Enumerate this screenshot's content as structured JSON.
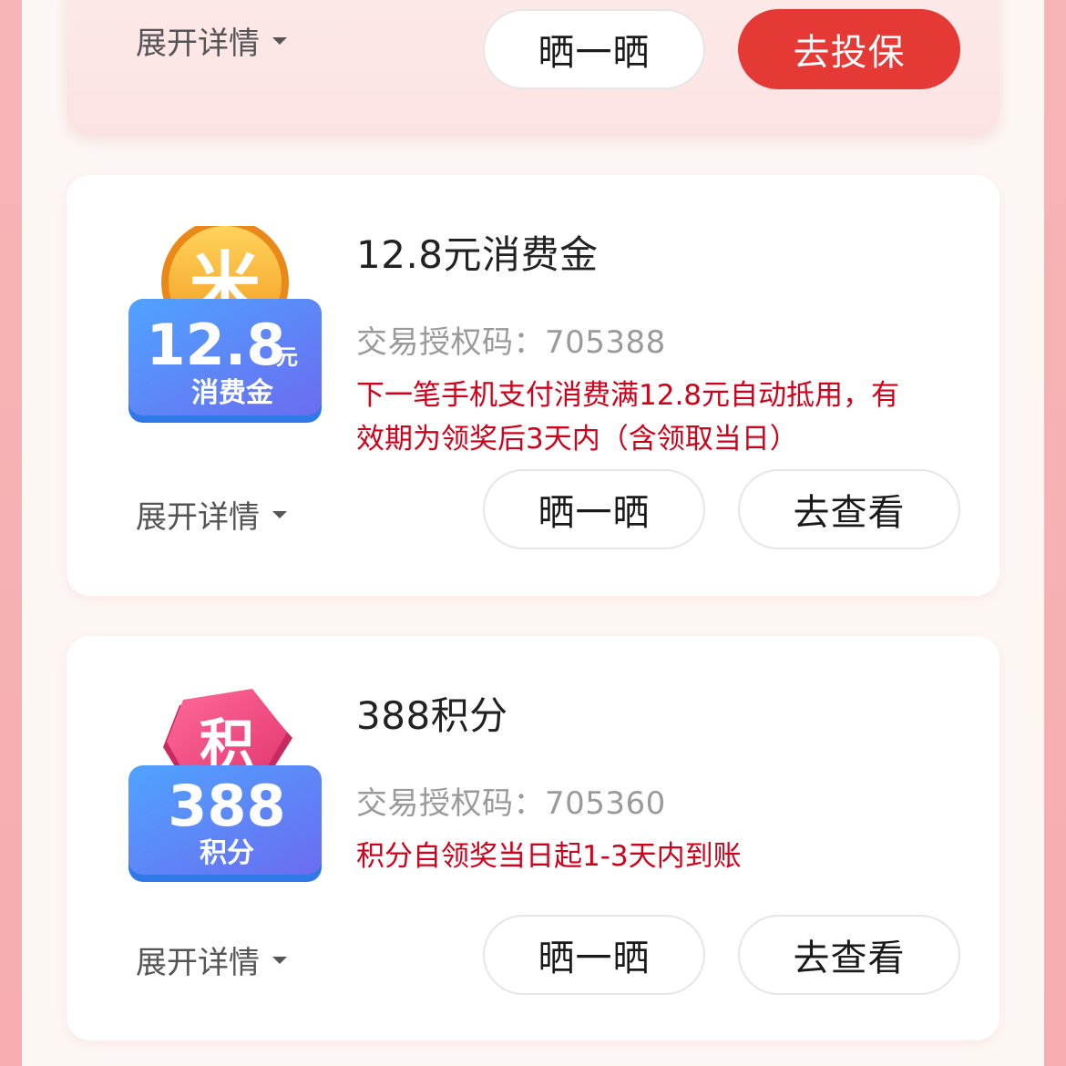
{
  "colors": {
    "accent_red": "#e53935",
    "desc_red": "#d0021b",
    "page_bg": "#fdf7f4",
    "edge_pink": "#f7b4b6"
  },
  "cards": [
    {
      "expand_label": "展开详情",
      "share_label": "晒一晒",
      "action_label": "去投保"
    },
    {
      "badge": {
        "amount": "12.8",
        "unit": "元",
        "subtitle": "消费金",
        "coin_char": "米"
      },
      "title": "12.8元消费金",
      "auth_code": "交易授权码：705388",
      "desc_line1": "下一笔手机支付消费满12.8元自动抵用，有",
      "desc_line2": "效期为领奖后3天内（含领取当日）",
      "expand_label": "展开详情",
      "share_label": "晒一晒",
      "action_label": "去查看"
    },
    {
      "badge": {
        "amount": "388",
        "subtitle": "积分",
        "tag_char": "积"
      },
      "title": "388积分",
      "auth_code": "交易授权码：705360",
      "desc_line1": "积分自领奖当日起1-3天内到账",
      "expand_label": "展开详情",
      "share_label": "晒一晒",
      "action_label": "去查看"
    }
  ],
  "icons": {
    "caret": "caret-down-icon",
    "coin": "coin-icon",
    "points_tag": "points-tag-icon"
  }
}
